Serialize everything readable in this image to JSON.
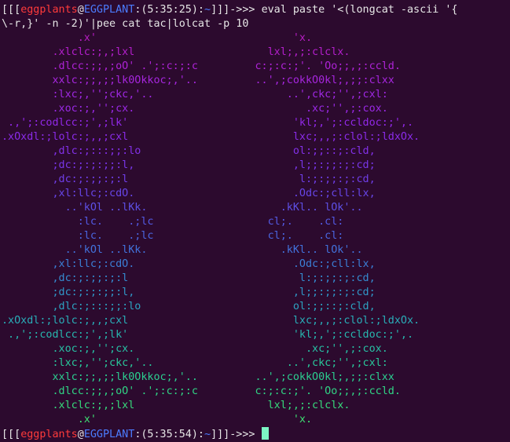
{
  "terminal": {
    "prompt1": {
      "open": "[[[",
      "user": "eggplants",
      "at": "@",
      "host": "EGGPLANT",
      "time": ":(5:35:25):",
      "path": "~",
      "close": "]]]->>> ",
      "command_line1": "eval paste '<(longcat -ascii '{",
      "command_line2": "\\-r,}' -n -2)'|pee cat tac|lolcat -p 10"
    },
    "art_lines": [
      {
        "text": "            .x'                               'x.",
        "color": "#b61dc2"
      },
      {
        "text": "        .xlclc:;,;lxl                     lxl;,;:clclx.",
        "color": "#b31fcc"
      },
      {
        "text": "        .dlcc:;;,;oO' .';:c:;:c         c:;:c:;'. 'Oo;;,;:ccld.",
        "color": "#ad23d6"
      },
      {
        "text": "        xxlc:;;,;;lk0Okkoc;,'..         ..',;cokkO0kl;,;;:clxx",
        "color": "#a626de"
      },
      {
        "text": "        :lxc;,'';ckc,'..                     ..',ckc;'',;cxl:",
        "color": "#9f28e3"
      },
      {
        "text": "        .xoc:;,'';cx.                           .xc;'',;:cox.",
        "color": "#9a29e6"
      },
      {
        "text": " .,';:codlcc:;',;lk'                          'kl;,';:ccldoc:;',.",
        "color": "#9128e8"
      },
      {
        "text": ".xOxdl:;lolc:;,,;cxl                          lxc;,,;:clol:;ldxOx.",
        "color": "#8a2be8"
      },
      {
        "text": "        ,dlc:;:::;;:lo                        ol:;;::;:cld,",
        "color": "#8230e8"
      },
      {
        "text": "        ;dc:;:;:;;:l,                         ,l;;:;;:;:cd;",
        "color": "#7836e8"
      },
      {
        "text": "        ,dc:;:;;:;:l                           l:;:;;:;:cd,",
        "color": "#6f3ee8"
      },
      {
        "text": "        ,xl:llc;:cdO.                         .Odc:;cll:lx,",
        "color": "#6746e8"
      },
      {
        "text": "          ..'kOl ..lKk.                     .kKl.. lOk'..",
        "color": "#5e50e6"
      },
      {
        "text": "            :lc.    .;lc                  cl;.    .cl:",
        "color": "#535ae4"
      },
      {
        "text": "            :lc.    .;lc                  cl;.    .cl:",
        "color": "#4a66e0"
      },
      {
        "text": "          ..'kOl ..lKk.                     .kKl.. lOk'..",
        "color": "#4272dc"
      },
      {
        "text": "        ,xl:llc;:cdO.                         .Odc:;cll:lx,",
        "color": "#3b7fd6"
      },
      {
        "text": "        ,dc:;:;;:;:l                           l:;:;;:;:cd,",
        "color": "#358bd0"
      },
      {
        "text": "        ;dc:;:;:;;:l,                         ,l;;:;;:;:cd;",
        "color": "#3097c8"
      },
      {
        "text": "        ,dlc:;:::;;:lo                        ol:;;::;:cld,",
        "color": "#2ca2c0"
      },
      {
        "text": ".xOxdl:;lolc:;,,;cxl                          lxc;,,;:clol:;ldxOx.",
        "color": "#29adb8"
      },
      {
        "text": " .,';:codlcc:;',;lk'                          'kl;,';:ccldoc:;',.",
        "color": "#27b7ae"
      },
      {
        "text": "        .xoc:;,'';cx.                           .xc;'',;:cox.",
        "color": "#27c0a4"
      },
      {
        "text": "        :lxc;,'';ckc,'..                     ..',ckc;'',;cxl:",
        "color": "#28c89a"
      },
      {
        "text": "        xxlc:;;,;;lk0Okkoc;,'..         ..',;cokkO0kl;,;;:clxx",
        "color": "#2bcf90"
      },
      {
        "text": "        .dlcc:;;,;oO' .';:c:;:c         c:;:c:;'. 'Oo;;,;:ccld.",
        "color": "#30d585"
      },
      {
        "text": "        .xlclc:;,;lxl                     lxl;,;:clclx.",
        "color": "#36da7b"
      },
      {
        "text": "            .x'                               'x.",
        "color": "#3ddf72"
      }
    ],
    "prompt2": {
      "open": "[[[",
      "user": "eggplants",
      "at": "@",
      "host": "EGGPLANT",
      "time": ":(5:35:54):",
      "path": "~",
      "close": "]]]->>> "
    },
    "colors": {
      "background": "#2c0a2e",
      "text": "#e6e6e6",
      "user": "#ff3b3b",
      "host": "#4b7cff",
      "cursor": "#7cf6c4"
    }
  }
}
